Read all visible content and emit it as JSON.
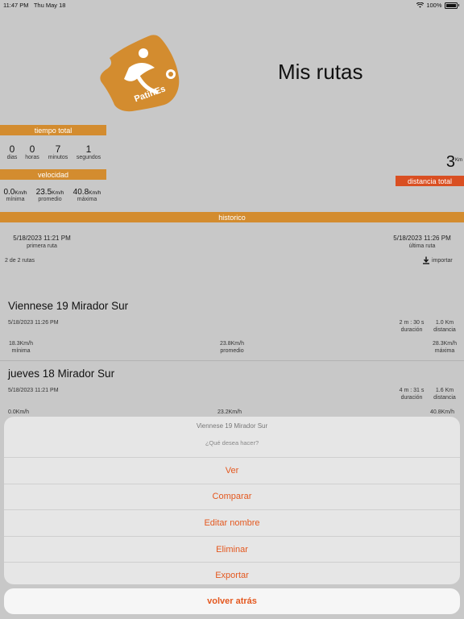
{
  "status_bar": {
    "time": "11:47 PM",
    "date": "Thu May 18",
    "battery": "100%"
  },
  "header": {
    "title": "Mis rutas",
    "logo_text": "PatinEs"
  },
  "tiempo_total": {
    "label": "tiempo total",
    "items": [
      {
        "value": "0",
        "label": "dias"
      },
      {
        "value": "0",
        "label": "horas"
      },
      {
        "value": "7",
        "label": "minutos"
      },
      {
        "value": "1",
        "label": "segundos"
      }
    ]
  },
  "velocidad": {
    "label": "velocidad",
    "unit": "Km/h",
    "items": [
      {
        "value": "0.0",
        "label": "mínima"
      },
      {
        "value": "23.5",
        "label": "promedio"
      },
      {
        "value": "40.8",
        "label": "máxima"
      }
    ]
  },
  "distancia_total": {
    "value": "3",
    "unit": "Km",
    "label": "distancia total"
  },
  "historico": {
    "label": "historico",
    "first_date": "5/18/2023 11:21 PM",
    "first_label": "primera ruta",
    "last_date": "5/18/2023 11:26 PM",
    "last_label": "última ruta",
    "count": "2 de 2 rutas",
    "import_label": "importar"
  },
  "routes": [
    {
      "name": "Viennese 19 Mirador Sur",
      "date": "5/18/2023 11:26 PM",
      "duration": "2 m : 30 s",
      "duration_label": "duración",
      "distance": "1.0 Km",
      "distance_label": "distancia",
      "min": "18.3Km/h",
      "min_label": "mínima",
      "avg": "23.8Km/h",
      "avg_label": "promedio",
      "max": "28.3Km/h",
      "max_label": "máxima"
    },
    {
      "name": "jueves 18 Mirador Sur",
      "date": "5/18/2023 11:21 PM",
      "duration": "4 m : 31 s",
      "duration_label": "duración",
      "distance": "1.6 Km",
      "distance_label": "distancia",
      "min": "0.0Km/h",
      "avg": "23.2Km/h",
      "max": "40.8Km/h"
    }
  ],
  "action_sheet": {
    "title": "Viennese 19 Mirador Sur",
    "message": "¿Qué desea hacer?",
    "actions": [
      "Ver",
      "Comparar",
      "Editar nombre",
      "Eliminar",
      "Exportar"
    ],
    "cancel": "volver atrás"
  },
  "colors": {
    "orange": "#d38c2f",
    "red_orange": "#d94f22",
    "action_text": "#e4581f"
  }
}
